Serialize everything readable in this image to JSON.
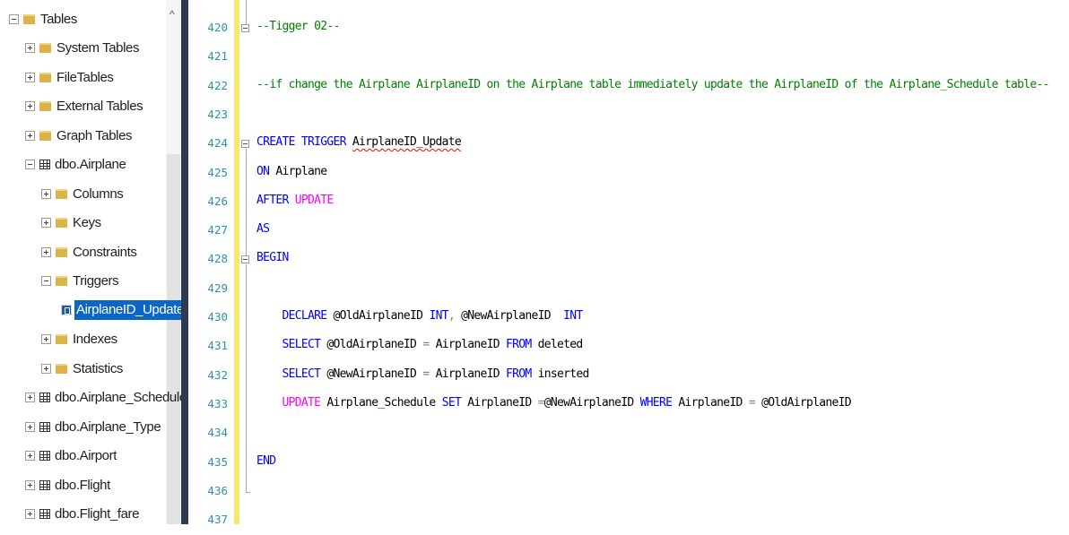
{
  "explorer": {
    "items": [
      {
        "label": "Tables",
        "kind": "folder",
        "expander": "minus",
        "indent": 0
      },
      {
        "label": "System Tables",
        "kind": "folder",
        "expander": "plus",
        "indent": 1
      },
      {
        "label": "FileTables",
        "kind": "folder",
        "expander": "plus",
        "indent": 1
      },
      {
        "label": "External Tables",
        "kind": "folder",
        "expander": "plus",
        "indent": 1
      },
      {
        "label": "Graph Tables",
        "kind": "folder",
        "expander": "plus",
        "indent": 1
      },
      {
        "label": "dbo.Airplane",
        "kind": "table",
        "expander": "minus",
        "indent": 1
      },
      {
        "label": "Columns",
        "kind": "folder",
        "expander": "plus",
        "indent": 2
      },
      {
        "label": "Keys",
        "kind": "folder",
        "expander": "plus",
        "indent": 2
      },
      {
        "label": "Constraints",
        "kind": "folder",
        "expander": "plus",
        "indent": 2
      },
      {
        "label": "Triggers",
        "kind": "folder",
        "expander": "minus",
        "indent": 2
      },
      {
        "label": "AirplaneID_Update",
        "kind": "trigger",
        "expander": "none",
        "indent": 3,
        "selected": true
      },
      {
        "label": "Indexes",
        "kind": "folder",
        "expander": "plus",
        "indent": 2
      },
      {
        "label": "Statistics",
        "kind": "folder",
        "expander": "plus",
        "indent": 2
      },
      {
        "label": "dbo.Airplane_Schedule",
        "kind": "table",
        "expander": "plus",
        "indent": 1
      },
      {
        "label": "dbo.Airplane_Type",
        "kind": "table",
        "expander": "plus",
        "indent": 1
      },
      {
        "label": "dbo.Airport",
        "kind": "table",
        "expander": "plus",
        "indent": 1
      },
      {
        "label": "dbo.Flight",
        "kind": "table",
        "expander": "plus",
        "indent": 1
      },
      {
        "label": "dbo.Flight_fare",
        "kind": "table",
        "expander": "plus",
        "indent": 1
      }
    ],
    "scroll_up_glyph": "^"
  },
  "editor": {
    "lines": [
      {
        "n": "420",
        "tokens": [
          {
            "t": "--Tigger 02--",
            "c": "cm"
          }
        ]
      },
      {
        "n": "421",
        "tokens": []
      },
      {
        "n": "422",
        "tokens": [
          {
            "t": "--if change the Airplane AirplaneID on the Airplane table immediately update the AirplaneID of the Airplane_Schedule table--",
            "c": "cm"
          }
        ]
      },
      {
        "n": "423",
        "tokens": []
      },
      {
        "n": "424",
        "tokens": [
          {
            "t": "CREATE TRIGGER ",
            "c": "kw"
          },
          {
            "t": "AirplaneID_Update",
            "c": "tx squiggle"
          }
        ]
      },
      {
        "n": "425",
        "tokens": [
          {
            "t": "ON ",
            "c": "kw"
          },
          {
            "t": "Airplane",
            "c": "tx"
          }
        ]
      },
      {
        "n": "426",
        "tokens": [
          {
            "t": "AFTER ",
            "c": "kw"
          },
          {
            "t": "UPDATE",
            "c": "kw2"
          }
        ]
      },
      {
        "n": "427",
        "tokens": [
          {
            "t": "AS",
            "c": "kw"
          }
        ]
      },
      {
        "n": "428",
        "tokens": [
          {
            "t": "BEGIN",
            "c": "kw"
          }
        ]
      },
      {
        "n": "429",
        "tokens": []
      },
      {
        "n": "430",
        "tokens": [
          {
            "t": "    DECLARE ",
            "c": "kw"
          },
          {
            "t": "@OldAirplaneID ",
            "c": "tx"
          },
          {
            "t": "INT",
            "c": "kw"
          },
          {
            "t": ", ",
            "c": "op"
          },
          {
            "t": "@NewAirplaneID  ",
            "c": "tx"
          },
          {
            "t": "INT",
            "c": "kw"
          }
        ]
      },
      {
        "n": "431",
        "tokens": [
          {
            "t": "    SELECT ",
            "c": "kw"
          },
          {
            "t": "@OldAirplaneID ",
            "c": "tx"
          },
          {
            "t": "= ",
            "c": "op"
          },
          {
            "t": "AirplaneID ",
            "c": "tx"
          },
          {
            "t": "FROM ",
            "c": "kw"
          },
          {
            "t": "deleted",
            "c": "tx"
          }
        ]
      },
      {
        "n": "432",
        "tokens": [
          {
            "t": "    SELECT ",
            "c": "kw"
          },
          {
            "t": "@NewAirplaneID ",
            "c": "tx"
          },
          {
            "t": "= ",
            "c": "op"
          },
          {
            "t": "AirplaneID ",
            "c": "tx"
          },
          {
            "t": "FROM ",
            "c": "kw"
          },
          {
            "t": "inserted",
            "c": "tx"
          }
        ]
      },
      {
        "n": "433",
        "tokens": [
          {
            "t": "    UPDATE ",
            "c": "kw2"
          },
          {
            "t": "Airplane_Schedule ",
            "c": "tx"
          },
          {
            "t": "SET ",
            "c": "kw"
          },
          {
            "t": "AirplaneID ",
            "c": "tx"
          },
          {
            "t": "=",
            "c": "op"
          },
          {
            "t": "@NewAirplaneID ",
            "c": "tx"
          },
          {
            "t": "WHERE ",
            "c": "kw"
          },
          {
            "t": "AirplaneID ",
            "c": "tx"
          },
          {
            "t": "= ",
            "c": "op"
          },
          {
            "t": "@OldAirplaneID",
            "c": "tx"
          }
        ]
      },
      {
        "n": "434",
        "tokens": []
      },
      {
        "n": "435",
        "tokens": [
          {
            "t": "END",
            "c": "kw"
          }
        ]
      },
      {
        "n": "436",
        "tokens": []
      },
      {
        "n": "437",
        "tokens": []
      }
    ]
  }
}
